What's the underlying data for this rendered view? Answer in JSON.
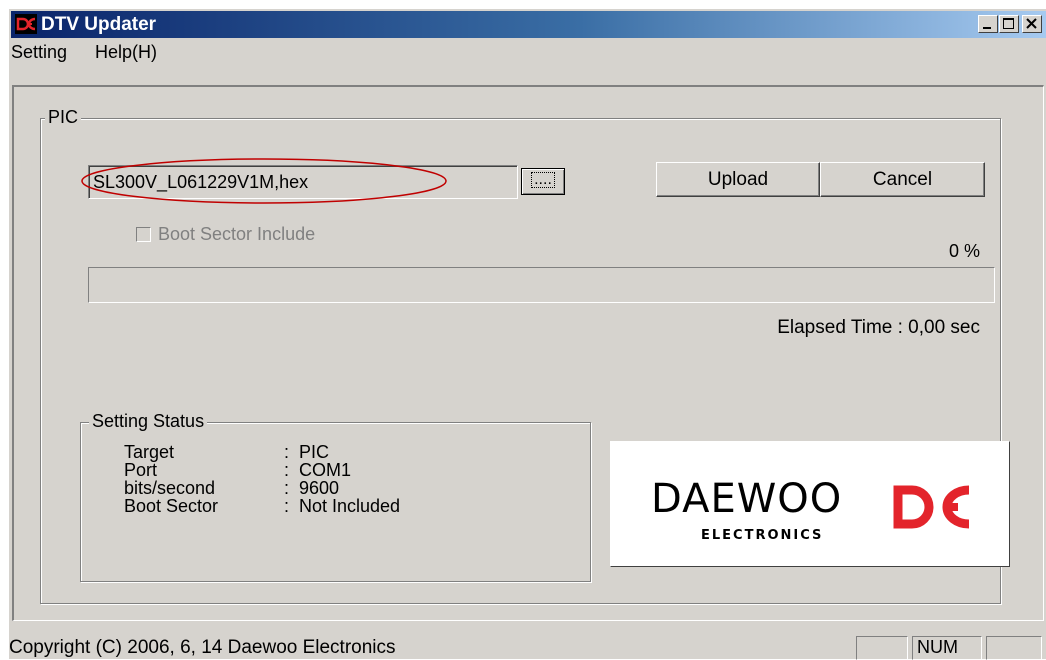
{
  "window": {
    "title": "DTV Updater"
  },
  "menu": {
    "items": [
      "Setting",
      "Help(H)"
    ]
  },
  "pic_group": {
    "legend": "PIC",
    "file_value": "SL300V_L061229V1M,hex",
    "browse_label": "....",
    "upload_label": "Upload",
    "cancel_label": "Cancel",
    "boot_sector_label": "Boot Sector Include",
    "boot_sector_checked": false,
    "progress_percent_text": "0 %",
    "progress_value": 0,
    "elapsed_text": "Elapsed Time : 0,00 sec"
  },
  "setting_status": {
    "legend": "Setting Status",
    "rows": [
      {
        "key": "Target",
        "colon": ":",
        "value": "PIC"
      },
      {
        "key": "Port",
        "colon": ":",
        "value": "COM1"
      },
      {
        "key": "bits/second",
        "colon": ":",
        "value": "9600"
      },
      {
        "key": "Boot Sector",
        "colon": ":",
        "value": "Not Included"
      }
    ]
  },
  "logo": {
    "brand": "DAEWOO",
    "sub": "ELECTRONICS",
    "color": "#e3242b"
  },
  "statusbar": {
    "copyright": "Copyright (C) 2006, 6, 14 Daewoo Electronics",
    "num": "NUM"
  },
  "colors": {
    "titlebar_start": "#0a246a",
    "titlebar_end": "#a6caf0",
    "face": "#d6d3ce",
    "annotation": "#c00000"
  },
  "icons": [
    "app-logo-icon",
    "minimize-icon",
    "maximize-icon",
    "close-icon"
  ]
}
